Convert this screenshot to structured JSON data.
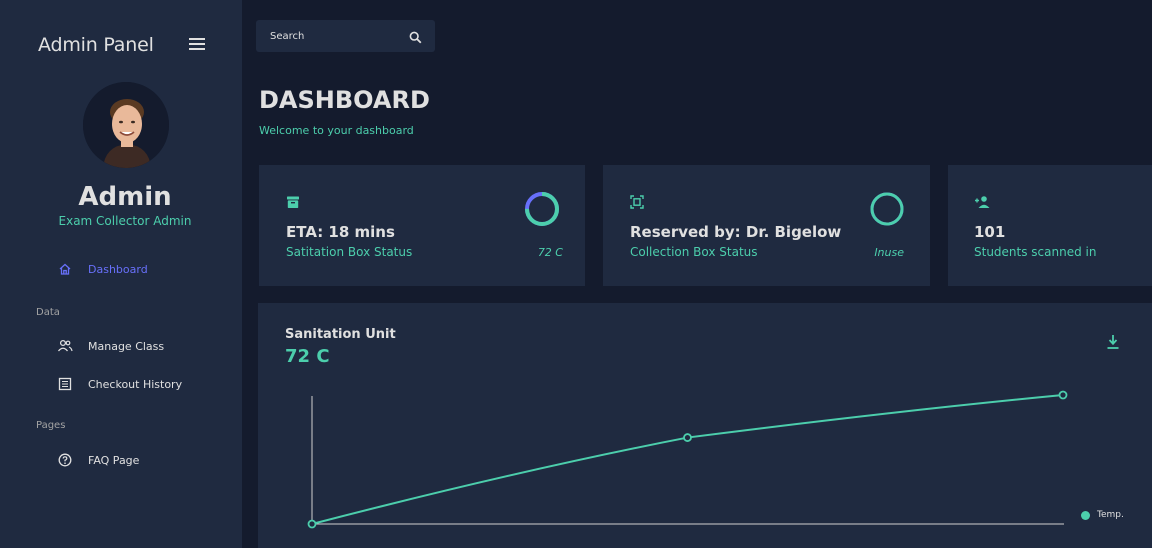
{
  "sidebar": {
    "app_title": "Admin Panel",
    "profile_name": "Admin",
    "profile_role": "Exam Collector Admin",
    "items": [
      {
        "label": "Dashboard",
        "icon": "home-icon"
      },
      {
        "label": "Manage Class",
        "icon": "people-icon"
      },
      {
        "label": "Checkout History",
        "icon": "receipt-icon"
      },
      {
        "label": "FAQ Page",
        "icon": "help-icon"
      }
    ],
    "sections": [
      "Data",
      "Pages"
    ]
  },
  "search": {
    "placeholder": "Search"
  },
  "header": {
    "title": "DASHBOARD",
    "subtitle": "Welcome to your dashboard"
  },
  "cards": [
    {
      "title": "ETA: 18 mins",
      "subtitle": "Satitation Box Status",
      "right": "72 C",
      "icon": "archive-icon",
      "progress": 0.75
    },
    {
      "title": "Reserved by: Dr. Bigelow",
      "subtitle": "Collection Box Status",
      "right": "Inuse",
      "icon": "qr-scan-icon",
      "progress": 1.0
    },
    {
      "title": "101",
      "subtitle": "Students scanned in",
      "icon": "person-add-icon"
    }
  ],
  "chart": {
    "title": "Sanitation Unit",
    "value": "72 C",
    "legend": "Temp."
  },
  "chart_data": {
    "type": "line",
    "series": [
      {
        "name": "Temp.",
        "values": [
          0,
          0.67,
          1.0
        ]
      }
    ],
    "x": [
      0,
      1,
      2
    ],
    "grid": false,
    "legend_position": "bottom-right"
  },
  "colors": {
    "accent": "#4cceac",
    "active": "#6870fa",
    "panel": "#1f2a40",
    "background": "#141b2d"
  }
}
